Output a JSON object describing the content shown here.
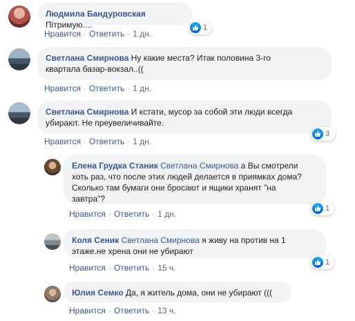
{
  "ui": {
    "like_label": "Нравится",
    "reply_label": "Ответить",
    "dot": "·"
  },
  "comments": [
    {
      "author": "Людмила Бандуровская",
      "text": "Пітримую....",
      "reactions": "1",
      "time": "1 дн."
    },
    {
      "author": "Светлана Смирнова",
      "text_line1": "Ну какие места? Итак половина 3-го",
      "text_line2": "квартала базар-вокзал..((",
      "time": "1 дн."
    },
    {
      "author": "Светлана Смирнова",
      "text_line1": "И кстати, мусор за собой эти люди всегда",
      "text_line2": "убирают. Не преувеличивайте.",
      "reactions": "3",
      "time": "1 дн."
    }
  ],
  "replies": [
    {
      "author": "Елена Грудка Станик",
      "mention": "Светлана Смирнова",
      "text_line1": "а Вы смотрели",
      "text_line2": "хоть раз, что после этих людей делается в приямках дома?",
      "text_line3": "Сколько там бумаги они бросают и ящики хранят \"на",
      "text_line4": "завтра\"?",
      "reactions": "1",
      "time": "1 дн."
    },
    {
      "author": "Коля Сеник",
      "mention": "Светлана Смирнова",
      "text_line1": "я живу на против на 1",
      "text_line2": "этаже.не хрена они не убирают",
      "reactions": "1",
      "time": "15 ч."
    },
    {
      "author": "Юлия Семко",
      "text_line1": "Да, я житель дома, они не убирают (((",
      "time": "13 ч."
    }
  ]
}
